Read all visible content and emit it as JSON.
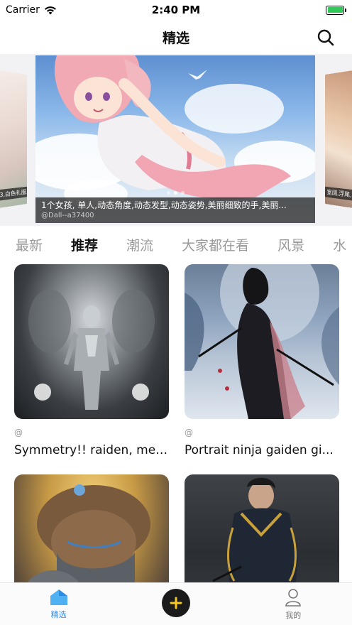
{
  "status_bar": {
    "carrier": "Carrier",
    "time": "2:40 PM"
  },
  "nav": {
    "title": "精选"
  },
  "banner": {
    "caption": "1个女孩, 单人,动态角度,动态发型,动态姿势,美丽细致的手,美丽...",
    "author": "@Dall--a37400",
    "left_caption": "3,白色礼服,",
    "right_caption": "宽阔,浮尾,梳发",
    "dot_count": 3,
    "active_dot": 1
  },
  "tabs": [
    {
      "label": "最新",
      "active": false
    },
    {
      "label": "推荐",
      "active": true
    },
    {
      "label": "潮流",
      "active": false
    },
    {
      "label": "大家都在看",
      "active": false
    },
    {
      "label": "风景",
      "active": false
    },
    {
      "label": "水",
      "active": false
    }
  ],
  "cards": [
    {
      "author": "@",
      "title": "Symmetry!! raiden, met..."
    },
    {
      "author": "@",
      "title": "Portrait ninja gaiden gi..."
    },
    {
      "author": "",
      "title": ""
    },
    {
      "author": "",
      "title": ""
    }
  ],
  "tab_bar": {
    "home_label": "精选",
    "mine_label": "我的"
  },
  "colors": {
    "accent_blue": "#2f8ce6",
    "tab_underline": "#f8d33a",
    "battery_green": "#34c759"
  }
}
